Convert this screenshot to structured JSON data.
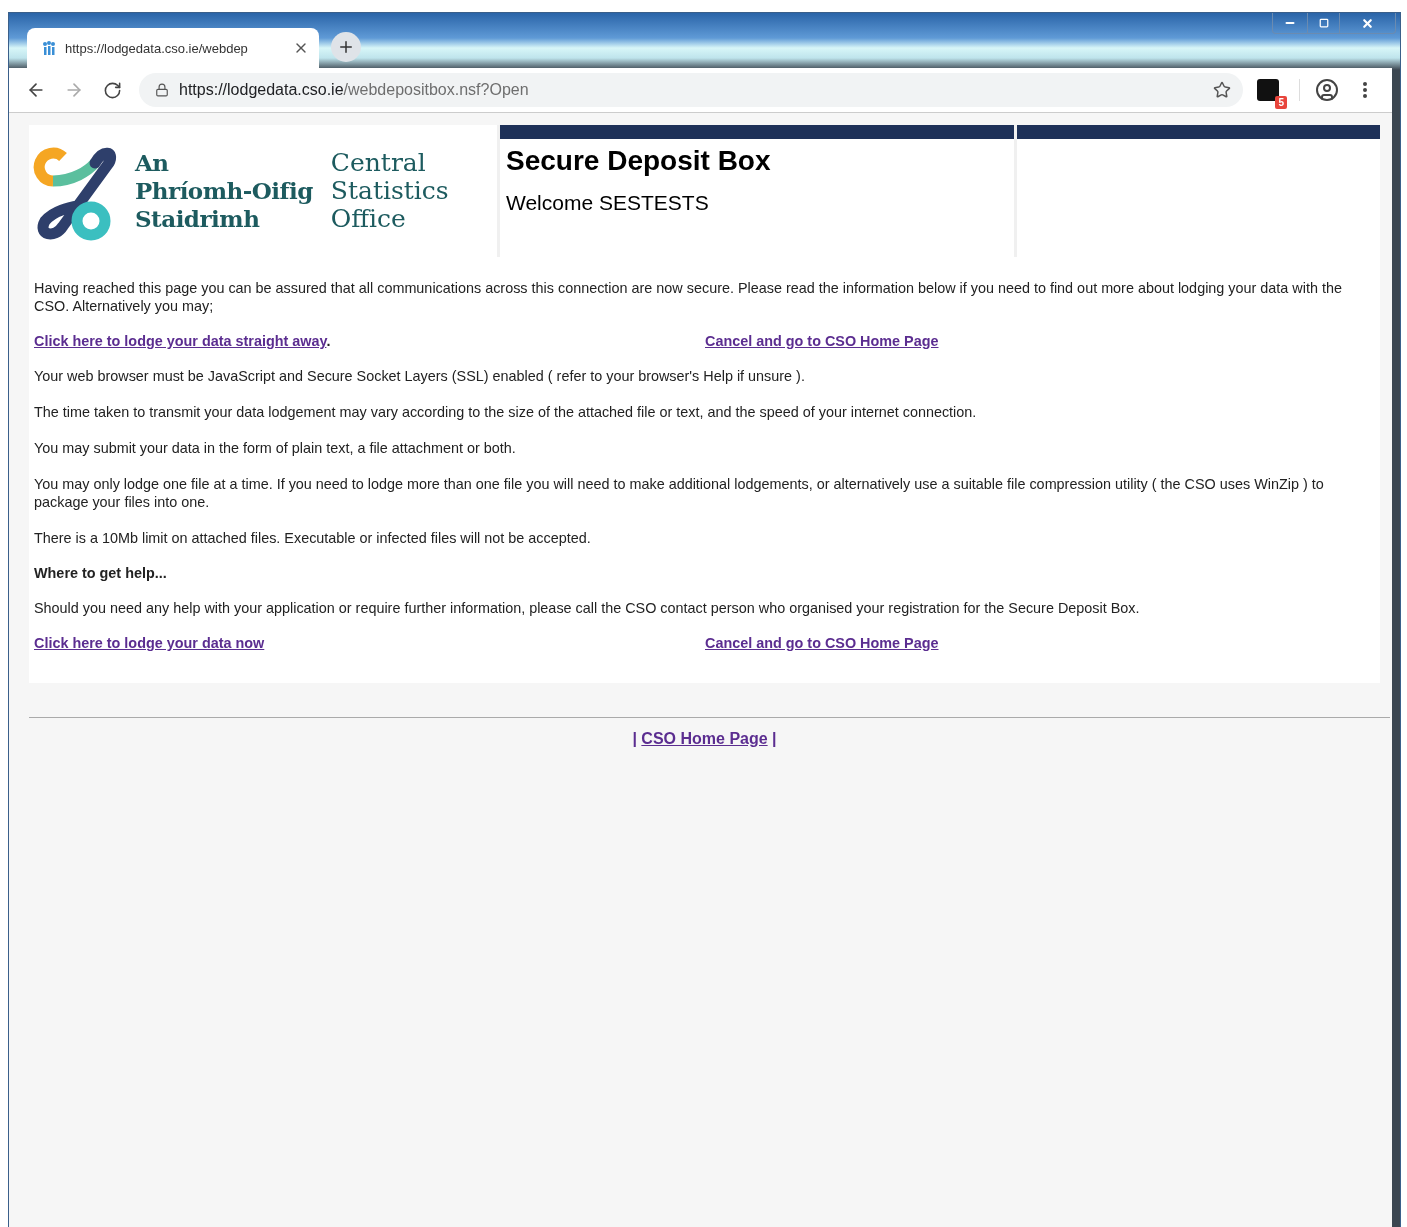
{
  "browser": {
    "tab_title": "https://lodgedata.cso.ie/webdep",
    "url_host": "https://lodgedata.cso.ie",
    "url_path": "/webdepositbox.nsf?Open",
    "extension_badge": "5"
  },
  "header": {
    "logo_irish": [
      "An",
      "Phríomh-Oifig",
      "Staidrimh"
    ],
    "logo_english": [
      "Central",
      "Statistics",
      "Office"
    ],
    "title": "Secure Deposit Box",
    "welcome": "Welcome SESTESTS"
  },
  "content": [
    {
      "kind": "paragraph",
      "text": "Having reached this page you can be assured that all communications across this connection are now secure. Please read the information below if you need to find out more about lodging your data with the CSO. Alternatively you may;"
    },
    {
      "kind": "links",
      "left": {
        "text": "Click here to lodge your data straight away",
        "suffix": "."
      },
      "right": {
        "text": "Cancel and go to CSO Home Page"
      }
    },
    {
      "kind": "paragraph",
      "text": "Your web browser must be JavaScript and Secure Socket Layers (SSL) enabled ( refer to your browser's Help if unsure )."
    },
    {
      "kind": "paragraph",
      "text": "The time taken to transmit your data lodgement may vary according to the size of the attached file or text, and the speed of your internet connection."
    },
    {
      "kind": "paragraph",
      "text": "You may submit your data in the form of plain text, a file attachment or both."
    },
    {
      "kind": "paragraph",
      "text": "You may only lodge one file at a time. If you need to lodge more than one file you will need to make additional lodgements, or alternatively use a suitable file compression utility ( the CSO uses WinZip ) to package your files into one."
    },
    {
      "kind": "paragraph",
      "text": "There is a 10Mb limit on attached files. Executable or infected files will not be accepted."
    },
    {
      "kind": "heading",
      "text": "Where to get help..."
    },
    {
      "kind": "paragraph",
      "text": "Should you need any help with your application or require further information, please call the CSO contact person who organised your registration for the Secure Deposit Box."
    },
    {
      "kind": "links",
      "left": {
        "text": "Click here to lodge your data now"
      },
      "right": {
        "text": "Cancel and go to CSO Home Page"
      }
    }
  ],
  "footer": {
    "left_separator": "|",
    "link": "CSO Home Page",
    "right_separator": "|"
  }
}
